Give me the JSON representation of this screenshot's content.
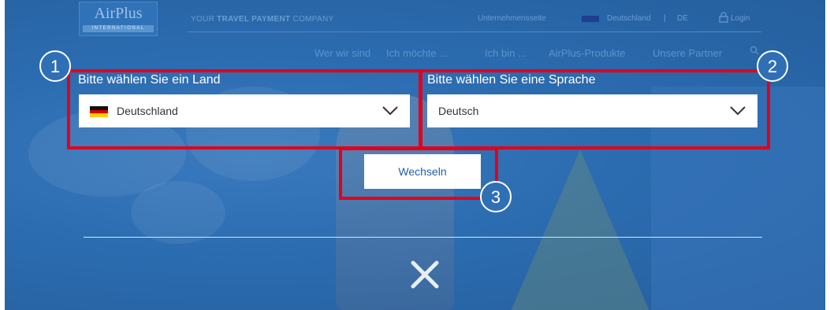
{
  "header": {
    "brand_name": "AirPlus",
    "brand_sub": "INTERNATIONAL",
    "tagline_prefix": "YOUR ",
    "tagline_bold": "TRAVEL PAYMENT",
    "tagline_suffix": " COMPANY",
    "util_company": "Unternehmensseite",
    "util_country": "Deutschland",
    "util_sep": "|",
    "util_lang": "DE",
    "util_login": "Login"
  },
  "nav": {
    "items": [
      "Wer wir sind",
      "Ich möchte ...",
      "Ich bin ...",
      "AirPlus-Produkte",
      "Unsere Partner"
    ]
  },
  "country_select": {
    "label": "Bitte wählen Sie ein Land",
    "value": "Deutschland"
  },
  "language_select": {
    "label": "Bitte wählen Sie eine Sprache",
    "value": "Deutsch"
  },
  "switch_button": {
    "label": "Wechseln"
  },
  "annotations": {
    "one": "1",
    "two": "2",
    "three": "3"
  },
  "colors": {
    "annotation_red": "#e3001b",
    "background_blue": "#2b6cb0",
    "button_text": "#1f5fa6"
  }
}
